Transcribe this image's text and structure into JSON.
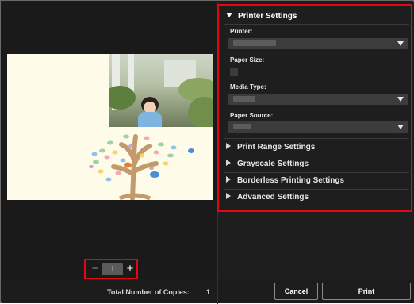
{
  "stepper": {
    "value": "1",
    "minus": "−",
    "plus": "+"
  },
  "settings": {
    "printer_settings": {
      "title": "Printer Settings",
      "printer_label": "Printer:",
      "paper_size_label": "Paper Size:",
      "media_type_label": "Media Type:",
      "paper_source_label": "Paper Source:"
    },
    "sections": [
      {
        "label": "Print Range Settings"
      },
      {
        "label": "Grayscale Settings"
      },
      {
        "label": "Borderless Printing Settings"
      },
      {
        "label": "Advanced Settings"
      }
    ]
  },
  "footer": {
    "copies_label": "Total Number of Copies:",
    "copies_value": "1",
    "cancel_label": "Cancel",
    "print_label": "Print"
  },
  "colors": {
    "highlight": "#e30613",
    "background": "#1b1b1b"
  }
}
